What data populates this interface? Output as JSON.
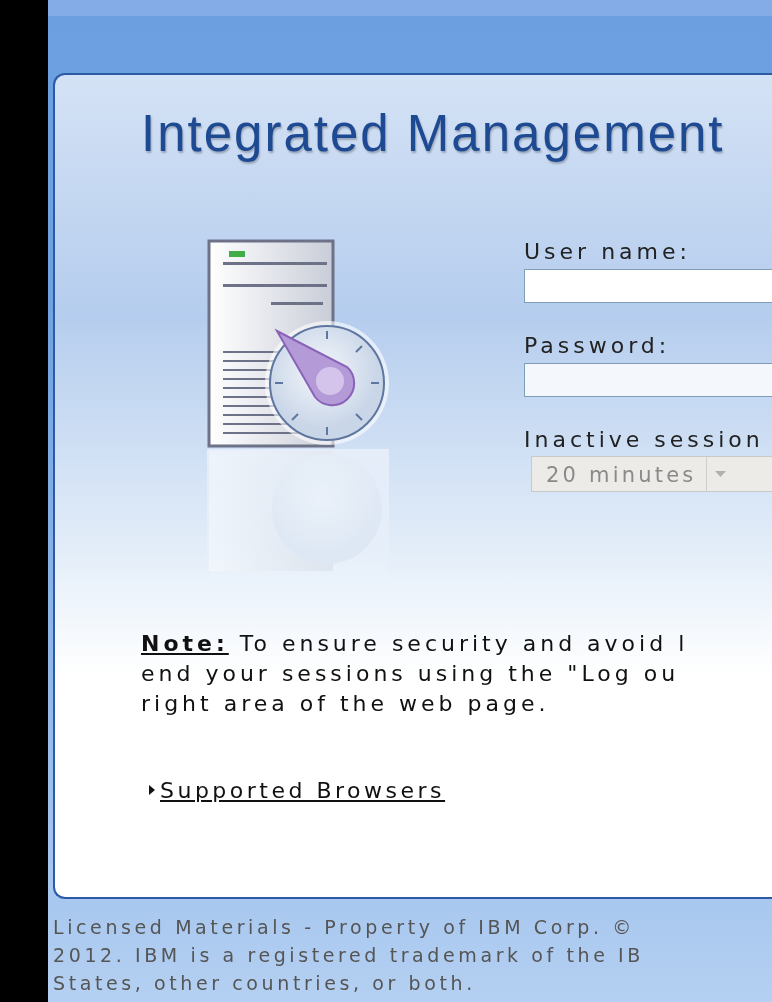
{
  "title": "Integrated Management",
  "fields": [
    {
      "label": "User name:"
    },
    {
      "label": "Password:"
    }
  ],
  "session_timeout": {
    "label": "Inactive session",
    "value": "20 minutes",
    "disabled": true
  },
  "note_lines": [
    "**Note:** To ensure security and avoid l",
    "end your sessions using the \"Log ou",
    "right area of the web page."
  ],
  "supported_browsers": {
    "label": "Supported Browsers",
    "expanded": false
  },
  "footer_lines": [
    "Licensed Materials - Property of IBM Corp. ©",
    "2012. IBM is a registered trademark of the IB",
    "States, other countries, or both."
  ]
}
